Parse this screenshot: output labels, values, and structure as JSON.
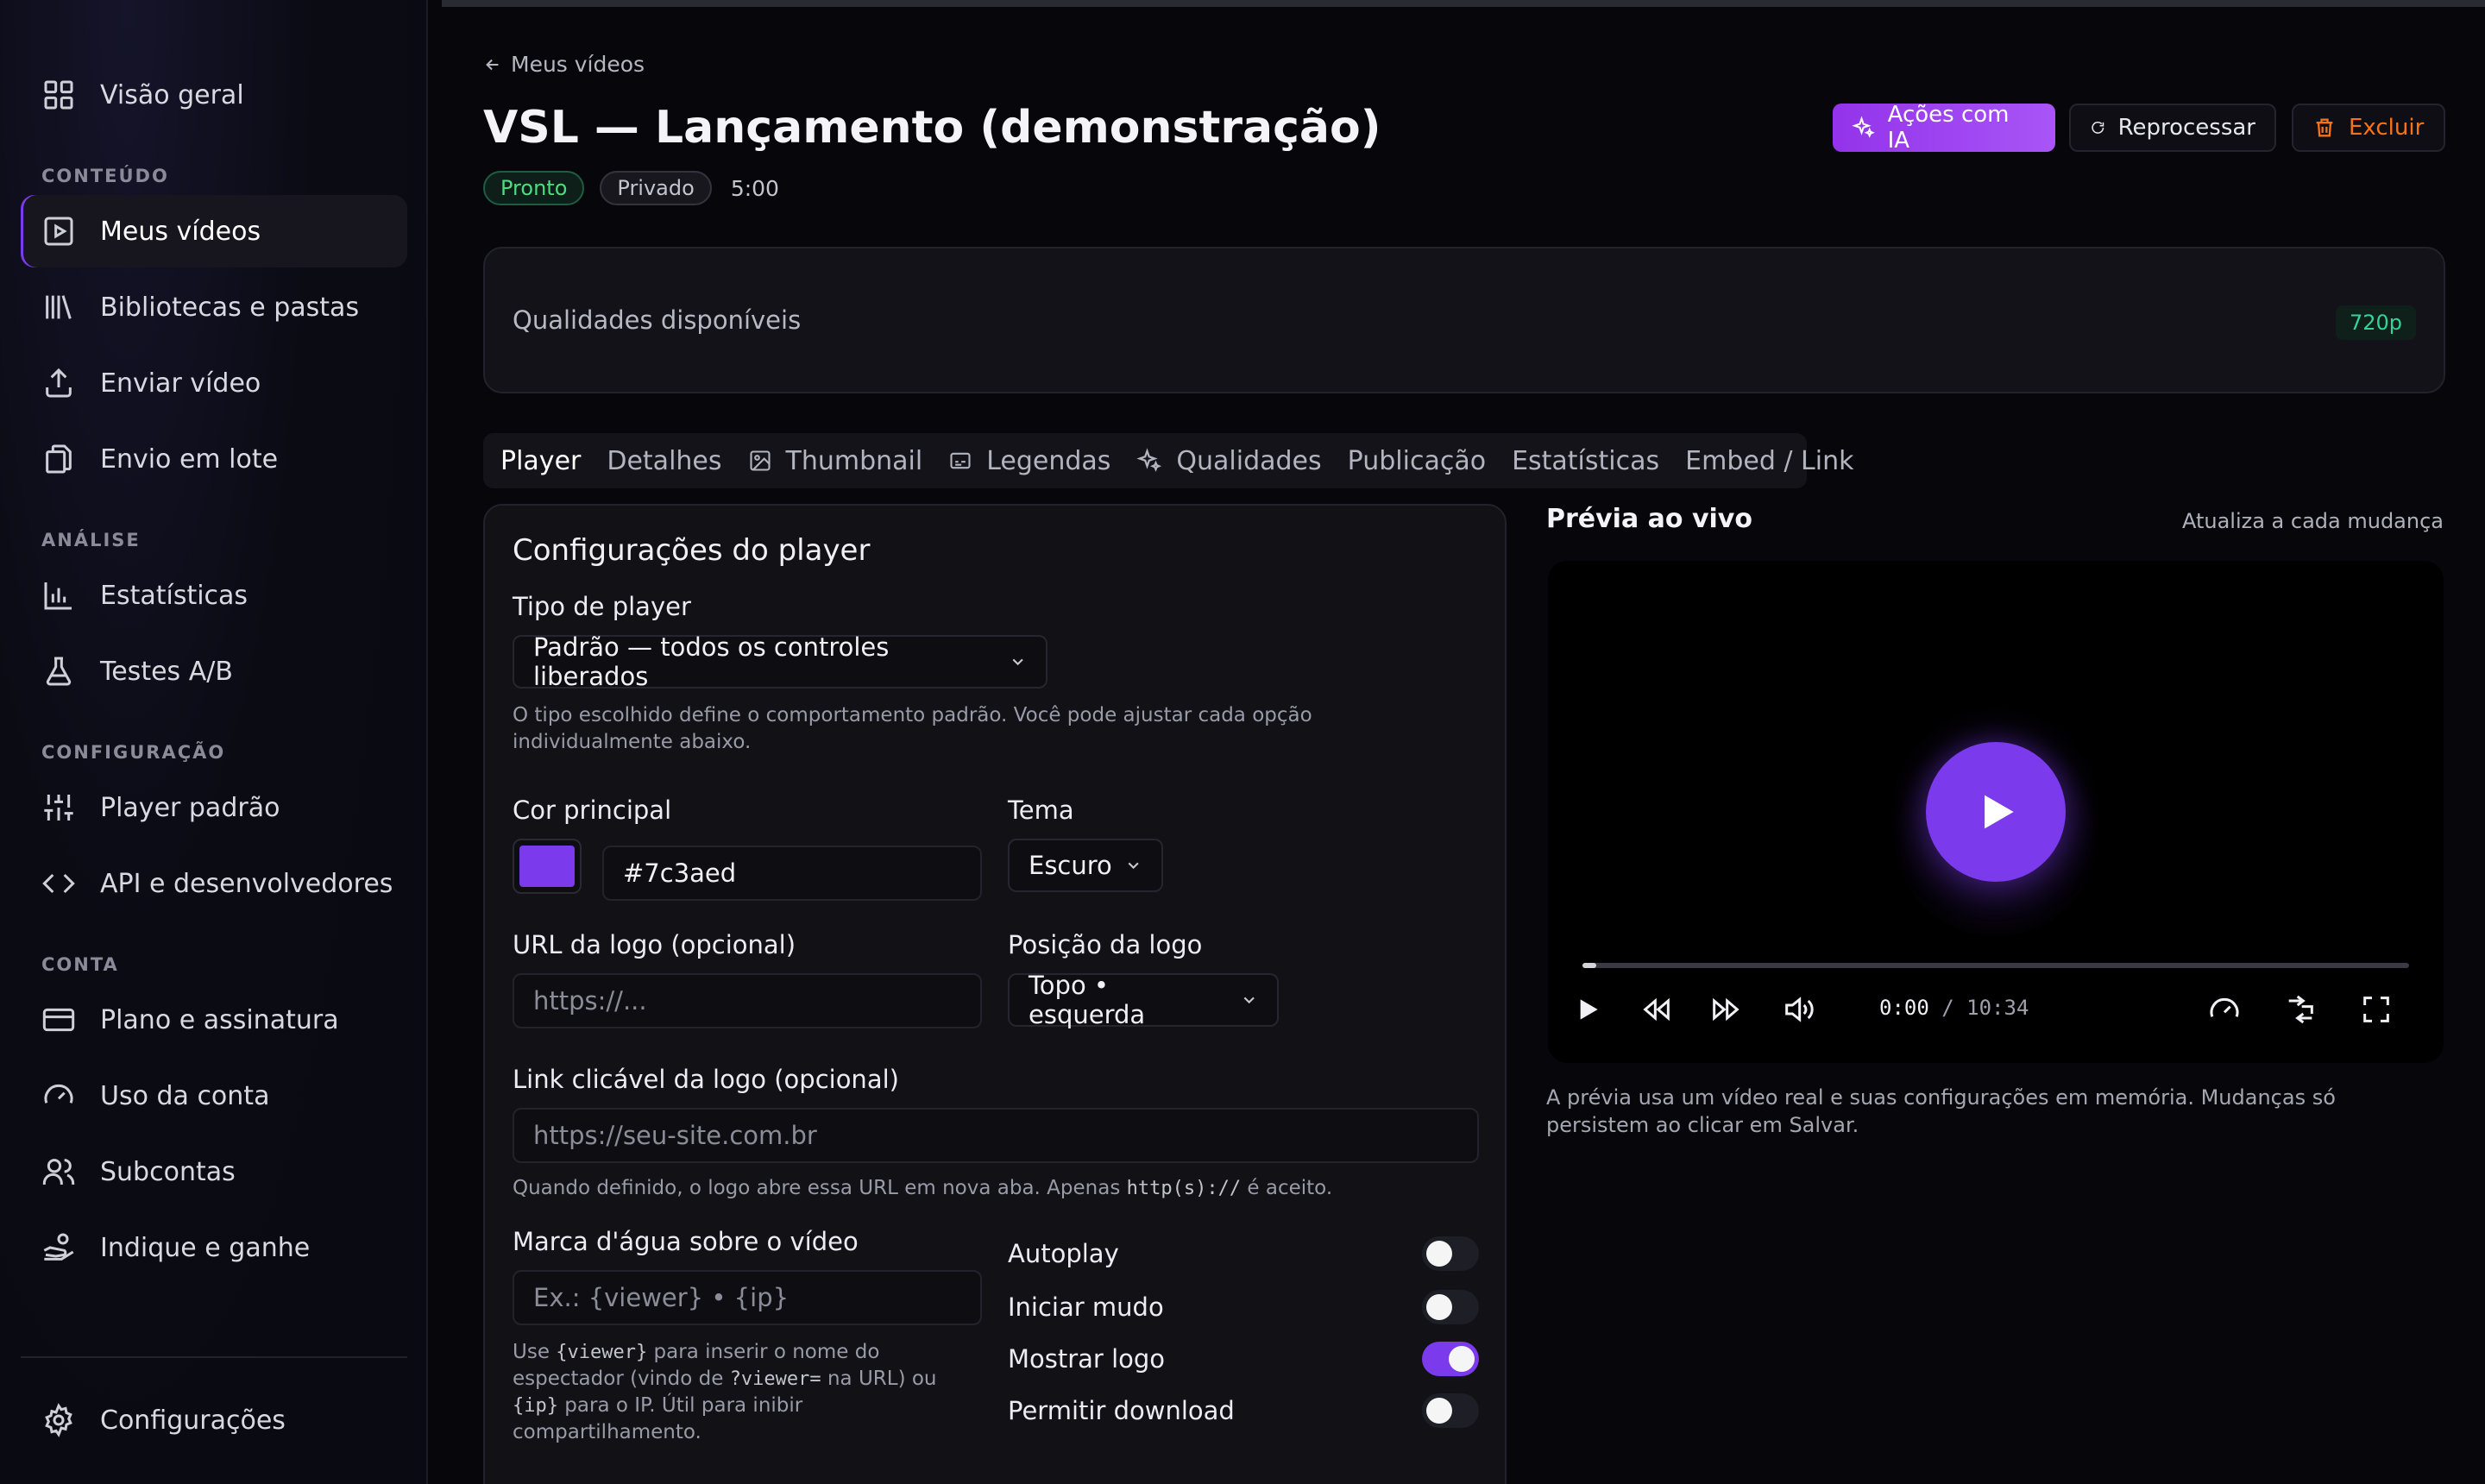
{
  "sidebar": {
    "overview": "Visão geral",
    "sections": {
      "content": "CONTEÚDO",
      "analysis": "ANÁLISE",
      "config": "CONFIGURAÇÃO",
      "account": "CONTA"
    },
    "items": {
      "videos": "Meus vídeos",
      "libraries": "Bibliotecas e pastas",
      "upload": "Enviar vídeo",
      "batch": "Envio em lote",
      "stats": "Estatísticas",
      "ab": "Testes A/B",
      "player": "Player padrão",
      "api": "API e desenvolvedores",
      "plan": "Plano e assinatura",
      "usage": "Uso da conta",
      "subaccounts": "Subcontas",
      "referral": "Indique e ganhe",
      "settings": "Configurações"
    }
  },
  "header": {
    "breadcrumb": "Meus vídeos",
    "title": "VSL — Lançamento (demonstração)",
    "status": "Pronto",
    "visibility": "Privado",
    "duration": "5:00",
    "ai_actions": "Ações com IA",
    "reprocess": "Reprocessar",
    "delete": "Excluir"
  },
  "qualities": {
    "label": "Qualidades disponíveis",
    "badge": "720p"
  },
  "tabs": [
    "Player",
    "Detalhes",
    "Thumbnail",
    "Legendas",
    "Qualidades",
    "Publicação",
    "Estatísticas",
    "Embed / Link"
  ],
  "settings": {
    "title": "Configurações do player",
    "player_type_label": "Tipo de player",
    "player_type_value": "Padrão — todos os controles liberados",
    "player_type_help": "O tipo escolhido define o comportamento padrão. Você pode ajustar cada opção individualmente abaixo.",
    "color_label": "Cor principal",
    "color_value": "#7c3aed",
    "theme_label": "Tema",
    "theme_value": "Escuro",
    "logo_url_label": "URL da logo (opcional)",
    "logo_url_placeholder": "https://...",
    "logo_pos_label": "Posição da logo",
    "logo_pos_value": "Topo • esquerda",
    "logo_link_label": "Link clicável da logo (opcional)",
    "logo_link_placeholder": "https://seu-site.com.br",
    "logo_link_help_1": "Quando definido, o logo abre essa URL em nova aba. Apenas ",
    "logo_link_help_code": "http(s)://",
    "logo_link_help_2": " é aceito.",
    "watermark_label": "Marca d'água sobre o vídeo",
    "watermark_placeholder": "Ex.: {viewer} • {ip}",
    "watermark_help": {
      "a": "Use ",
      "code1": "{viewer}",
      "b": " para inserir o nome do espectador (vindo de ",
      "code2": "?viewer=",
      "c": " na URL) ou ",
      "code3": "{ip}",
      "d": " para o IP. Útil para inibir compartilhamento."
    },
    "toggles": [
      {
        "label": "Autoplay",
        "on": false
      },
      {
        "label": "Iniciar mudo",
        "on": false
      },
      {
        "label": "Mostrar logo",
        "on": true
      },
      {
        "label": "Permitir download",
        "on": false
      }
    ]
  },
  "preview": {
    "title": "Prévia ao vivo",
    "note": "Atualiza a cada mudança",
    "time_current": "0:00",
    "time_sep": " / ",
    "time_total": "10:34",
    "progress": 0.017,
    "help": "A prévia usa um vídeo real e suas configurações em memória. Mudanças só persistem ao clicar em Salvar."
  },
  "colors": {
    "accent": "#7c3aed",
    "ready": "#4ade80",
    "danger": "#f97316"
  }
}
